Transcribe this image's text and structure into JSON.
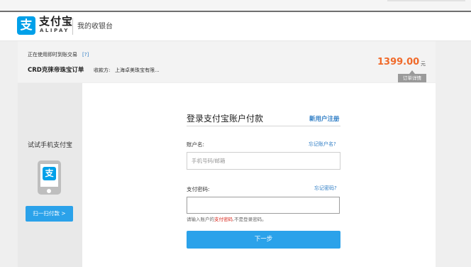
{
  "header": {
    "logo_icon": "alipay-logo-icon",
    "logo_glyph": "支",
    "brand_cn": "支付宝",
    "brand_en": "ALIPAY",
    "cashier_label": "我的收银台",
    "accent_color": "#00a0e9"
  },
  "order": {
    "trade_type": "正在使用即时到账交易",
    "help_link": "[?]",
    "title": "CRD克徕帝珠宝订单",
    "payee_label": "收款方:",
    "payee": "上海卓美珠宝有限...",
    "amount": "1399.00",
    "currency": "元",
    "details_button": "订单详情",
    "amount_color": "#f06a2a"
  },
  "mobile_pay": {
    "label": "试试手机支付宝",
    "phone_icon": "phone-alipay-icon",
    "phone_glyph": "支",
    "scan_button": "扫一扫付款 >"
  },
  "login": {
    "heading": "登录支付宝账户付款",
    "register_link": "新用户注册",
    "account_label": "账户名:",
    "forgot_account_link": "忘记账户名?",
    "account_placeholder": "手机号码/邮箱",
    "password_label": "支付密码:",
    "forgot_password_link": "忘记密码?",
    "hint_before": "请输入账户的",
    "hint_emphasis": "支付密码",
    "hint_after": ",不是登录密码。",
    "next_button": "下一步",
    "button_color": "#2ba2ea",
    "link_color": "#2e7dc5"
  }
}
